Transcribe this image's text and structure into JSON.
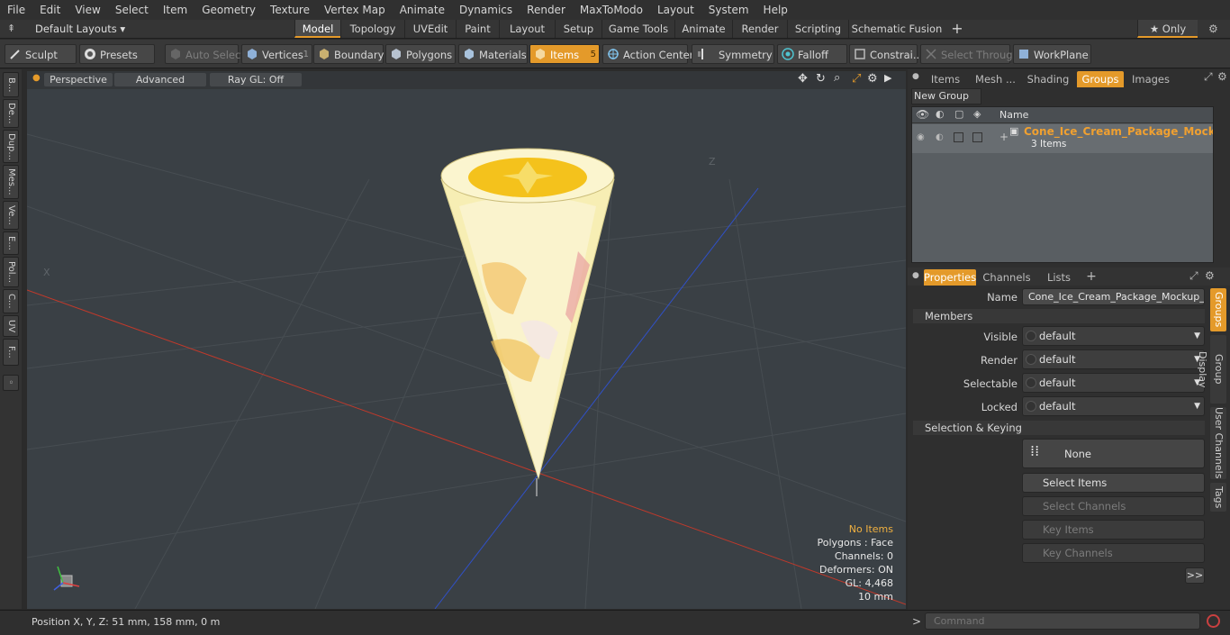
{
  "menu": [
    "File",
    "Edit",
    "View",
    "Select",
    "Item",
    "Geometry",
    "Texture",
    "Vertex Map",
    "Animate",
    "Dynamics",
    "Render",
    "MaxToModo",
    "Layout",
    "System",
    "Help"
  ],
  "layouts": {
    "label": "Default Layouts ▾",
    "tabs": [
      "Model",
      "Topology",
      "UVEdit",
      "Paint",
      "Layout",
      "Setup",
      "Game Tools",
      "Animate",
      "Render",
      "Scripting",
      "Schematic Fusion"
    ],
    "add": "+",
    "only": "★  Only",
    "active": "Model"
  },
  "toolbar": {
    "sculpt": "Sculpt",
    "presets": "Presets",
    "auto_select": "Auto Select",
    "vertices": "Vertices",
    "vertices_count": "1",
    "boundary": "Boundary",
    "polygons": "Polygons",
    "materials": "Materials",
    "items": "Items",
    "items_count": "5",
    "action_center": "Action Center",
    "symmetry": "Symmetry",
    "falloff": "Falloff",
    "constraints": "Constrai...",
    "select_through": "Select Through",
    "workplane": "WorkPlane"
  },
  "left_tabs": [
    "B...",
    "De...",
    "Dup...",
    "Mes...",
    "Ve...",
    "E...",
    "Pol...",
    "C...",
    "UV",
    "F..."
  ],
  "viewport": {
    "perspective": "Perspective",
    "advanced": "Advanced",
    "raygl": "Ray GL: Off",
    "info": {
      "items": "No Items",
      "polygons": "Polygons : Face",
      "channels": "Channels: 0",
      "deformers": "Deformers: ON",
      "gl": "GL: 4,468",
      "scale": "10 mm"
    },
    "axis_x": "X",
    "axis_z": "Z"
  },
  "status": {
    "position": "Position X, Y, Z:   51 mm, 158 mm, 0 m"
  },
  "groups_panel": {
    "tabs": [
      "Items",
      "Mesh ...",
      "Shading",
      "Groups",
      "Images"
    ],
    "active": "Groups",
    "new_group": "New Group",
    "column_name": "Name",
    "group_name": "Cone_Ice_Cream_Package_Mocku...",
    "group_count": "3 Items"
  },
  "properties": {
    "tabs": [
      "Properties",
      "Channels",
      "Lists"
    ],
    "add": "+",
    "name_label": "Name",
    "name_value": "Cone_Ice_Cream_Package_Mockup_Var",
    "members_section": "Members",
    "visible_label": "Visible",
    "visible_value": "default",
    "render_label": "Render",
    "render_value": "default",
    "selectable_label": "Selectable",
    "selectable_value": "default",
    "locked_label": "Locked",
    "locked_value": "default",
    "selection_section": "Selection & Keying",
    "none_label": "None",
    "select_items": "Select Items",
    "select_channels": "Select Channels",
    "key_items": "Key Items",
    "key_channels": "Key Channels",
    "more": ">>",
    "side_tabs": [
      "Groups",
      "Group Display",
      "User Channels",
      "Tags"
    ]
  },
  "command": {
    "prompt": ">",
    "placeholder": "Command"
  },
  "colors": {
    "accent": "#e49a2a",
    "group_name": "#f0a030",
    "x_axis": "#c0392b",
    "z_axis": "#3050c8"
  }
}
